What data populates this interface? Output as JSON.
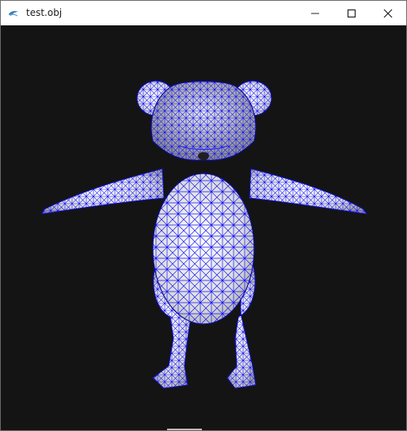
{
  "window": {
    "title": "test.obj",
    "app_icon": "python-feather-icon",
    "controls": [
      "minimize-icon",
      "maximize-icon",
      "close-icon"
    ]
  },
  "viewport": {
    "background": "#141414",
    "model": "mouse-character-wireframe",
    "mesh_fill": "#e6e6e6",
    "wire_color": "#1010ff"
  }
}
